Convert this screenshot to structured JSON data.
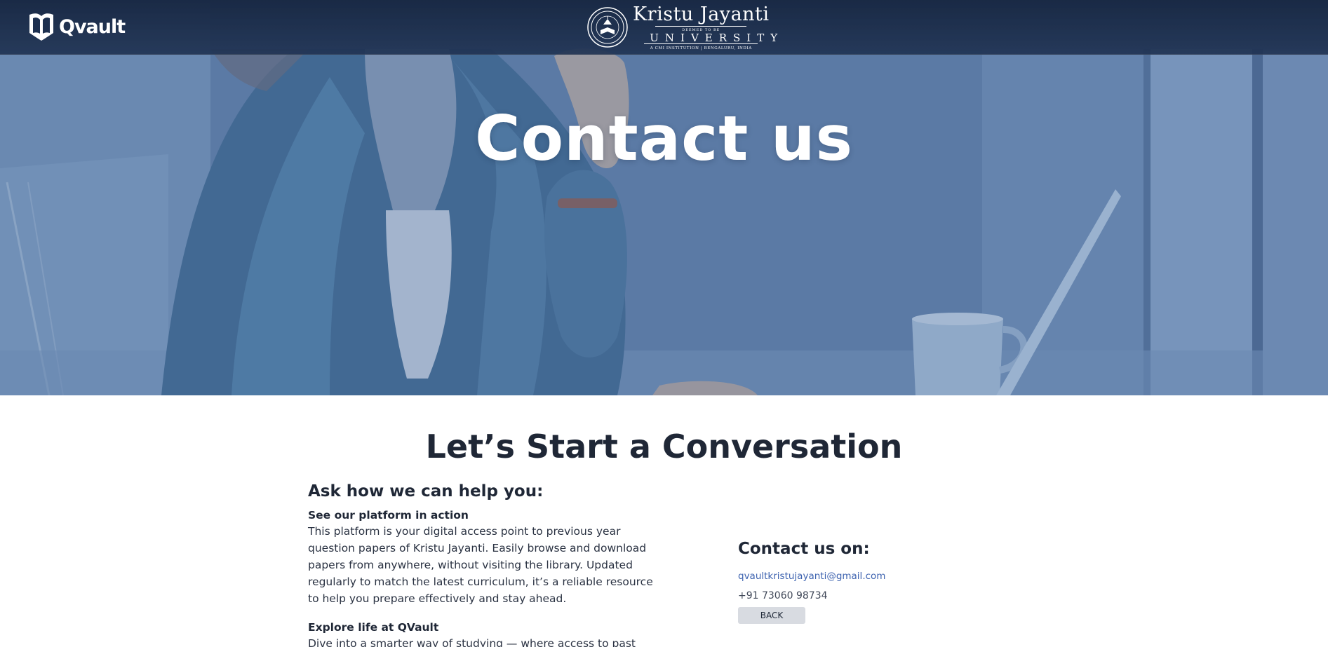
{
  "navbar": {
    "brand": "Qvault",
    "university": {
      "name": "Kristu Jayanti",
      "deemed": "DEEMED TO BE",
      "word": "UNIVERSITY",
      "subtitle": "A CMI INSTITUTION | BENGALURU, INDIA"
    }
  },
  "hero": {
    "title": "Contact us"
  },
  "main": {
    "heading": "Let’s Start a Conversation",
    "help_title": "Ask how we can help you:",
    "blocks": [
      {
        "title": "See our platform in action",
        "text": "This platform is your digital access point to previous year question papers of Kristu Jayanti. Easily browse and download papers from anywhere, without visiting the library. Updated regularly to match the latest curriculum, it’s a reliable resource to help you prepare effectively and stay ahead."
      },
      {
        "title": "Explore life at QVault",
        "text": "Dive into a smarter way of studying — where access to past papers is"
      }
    ]
  },
  "contact": {
    "title": "Contact us on:",
    "email": "qvaultkristujayanti@gmail.com",
    "phone": "+91 73060 98734",
    "back_label": "BACK"
  },
  "colors": {
    "navbar": "#1c2f4f",
    "hero_overlay": "#5f7fa9",
    "heading_text": "#1f2736",
    "link": "#3e63b0",
    "button_bg": "#d8dbe1"
  },
  "icons": {
    "brand": "open-book-shield-icon",
    "university": "university-seal-icon"
  }
}
